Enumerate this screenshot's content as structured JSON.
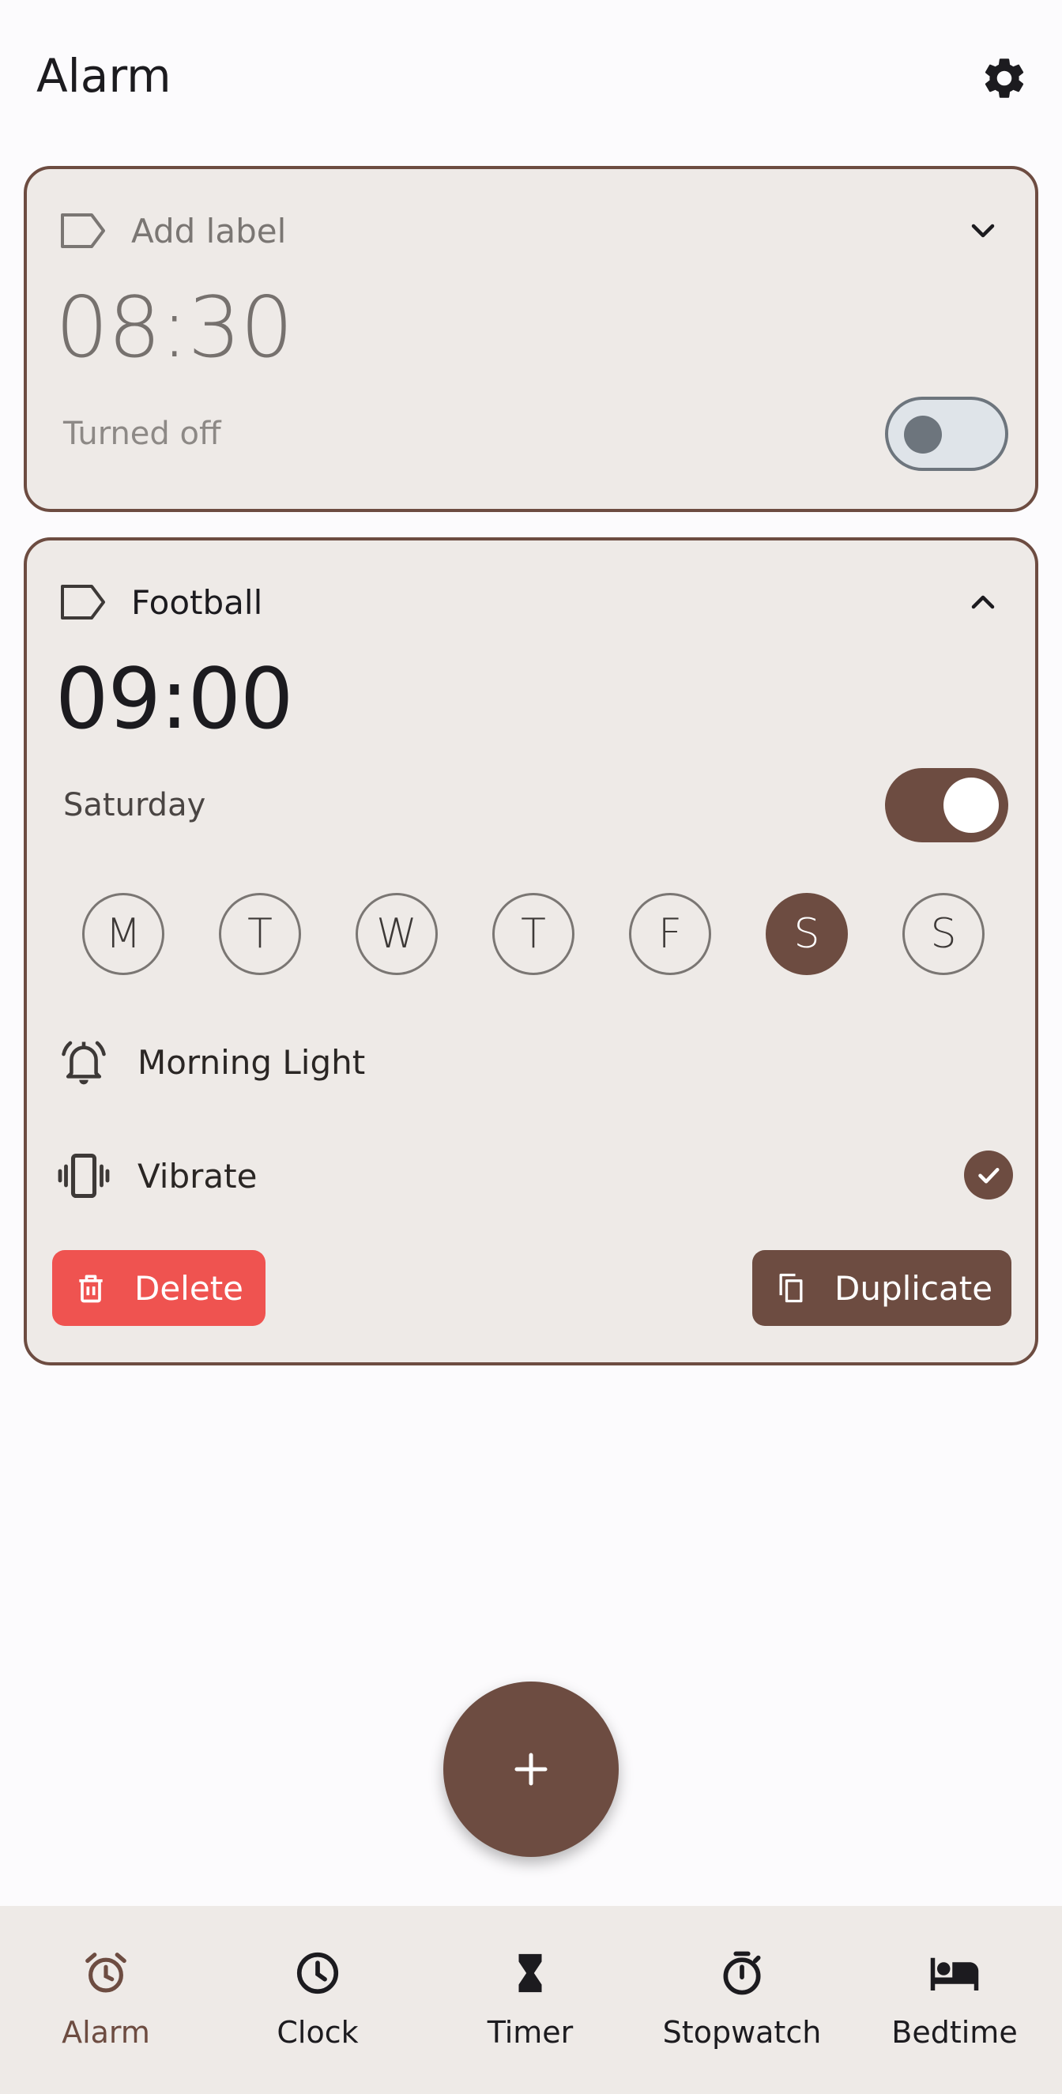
{
  "header": {
    "title": "Alarm",
    "settings_icon": "gear-icon"
  },
  "alarms": [
    {
      "label": "Add label",
      "time": "08:30",
      "status": "Turned off",
      "enabled": false,
      "expanded": false
    },
    {
      "label": "Football",
      "time": "09:00",
      "status": "Saturday",
      "enabled": true,
      "expanded": true,
      "days": [
        {
          "letter": "M",
          "selected": false
        },
        {
          "letter": "T",
          "selected": false
        },
        {
          "letter": "W",
          "selected": false
        },
        {
          "letter": "T",
          "selected": false
        },
        {
          "letter": "F",
          "selected": false
        },
        {
          "letter": "S",
          "selected": true
        },
        {
          "letter": "S",
          "selected": false
        }
      ],
      "sound": "Morning Light",
      "vibrate_label": "Vibrate",
      "vibrate": true,
      "delete_label": "Delete",
      "duplicate_label": "Duplicate"
    }
  ],
  "fab": {
    "icon": "plus-icon"
  },
  "nav": {
    "items": [
      {
        "label": "Alarm",
        "icon": "alarm-icon",
        "active": true
      },
      {
        "label": "Clock",
        "icon": "clock-icon",
        "active": false
      },
      {
        "label": "Timer",
        "icon": "hourglass-icon",
        "active": false
      },
      {
        "label": "Stopwatch",
        "icon": "stopwatch-icon",
        "active": false
      },
      {
        "label": "Bedtime",
        "icon": "bed-icon",
        "active": false
      }
    ]
  },
  "colors": {
    "accent": "#6d4c41",
    "card_bg": "#eeeae7",
    "delete": "#ef5350",
    "page_bg": "#fcfbfd"
  }
}
